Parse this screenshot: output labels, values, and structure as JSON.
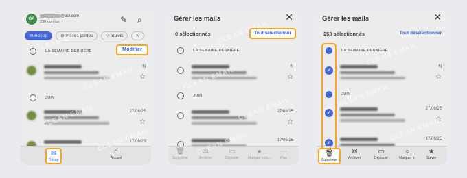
{
  "panel1": {
    "avatar": "GA",
    "email": "@aol.com",
    "unread": "230 non lus",
    "chips": [
      "Récep",
      "Pièces jointes",
      "Suivis",
      "N"
    ],
    "section1": "LA SEMAINE DERNIÈRE",
    "modify": "Modifier",
    "section2": "JUIN",
    "dates": [
      "6j",
      "27/06/25",
      "17/06/25"
    ],
    "tabs": {
      "inbox": "Récep",
      "home": "Accueil"
    }
  },
  "panel2": {
    "title": "Gérer les mails",
    "count": "0 sélectionnés",
    "select_all": "Tout sélectionner",
    "section1": "LA SEMAINE DERNIÈRE",
    "section2": "JUIN",
    "dates": [
      "6j",
      "27/06/25",
      "17/06/25"
    ],
    "actions": [
      "Supprimer",
      "Archiver",
      "Déplacer",
      "Marquer com...",
      "Plus"
    ]
  },
  "panel3": {
    "title": "Gérer les mails",
    "count": "258 sélectionnés",
    "deselect_all": "Tout désélectionner",
    "section1": "LA SEMAINE DERNIÈRE",
    "section2": "JUIN",
    "dates": [
      "6j",
      "27/06/25",
      "17/06/25"
    ],
    "actions": [
      "Supprimer",
      "Archiver",
      "Déplacer",
      "Marquer lu",
      "Suivre"
    ]
  },
  "watermark": "CLEAN EMAIL",
  "colors": {
    "accent": "#2f5ce8",
    "highlight": "#f5a623",
    "avatar": "#2f8a3c"
  }
}
